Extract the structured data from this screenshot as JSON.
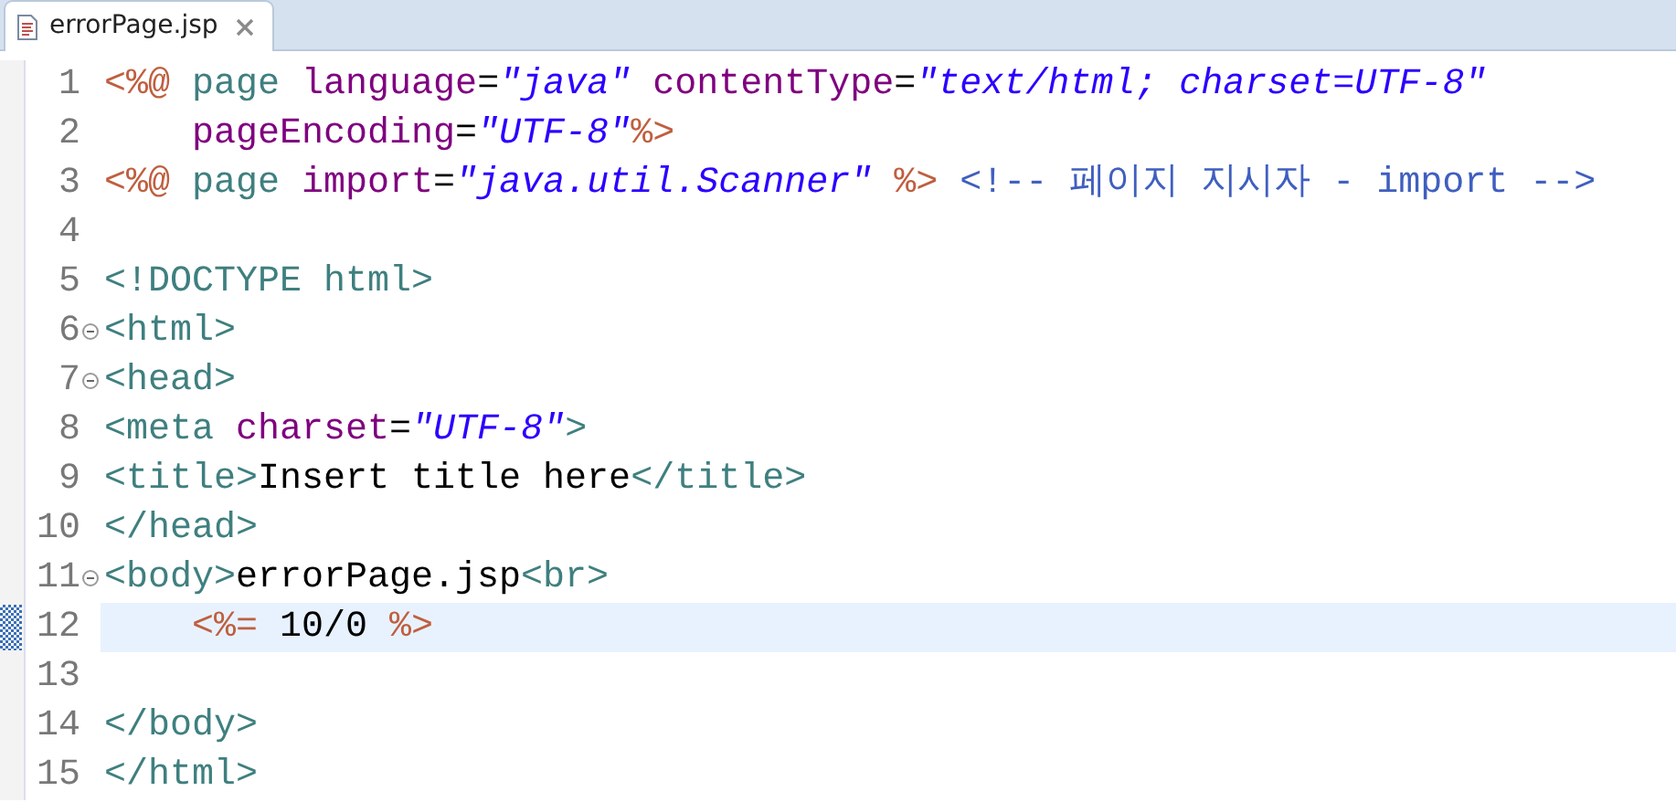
{
  "tab": {
    "title": "errorPage.jsp",
    "selected": true
  },
  "lines": [
    {
      "number": "1",
      "foldable": false,
      "current": false,
      "tokens": [
        {
          "kind": "jsp",
          "text": "<%@"
        },
        {
          "kind": "tag",
          "text": " page"
        },
        {
          "kind": "attr",
          "text": " language"
        },
        {
          "kind": "text",
          "text": "="
        },
        {
          "kind": "string",
          "text": "\"java\""
        },
        {
          "kind": "attr",
          "text": " contentType"
        },
        {
          "kind": "text",
          "text": "="
        },
        {
          "kind": "string",
          "text": "\"text/html; charset=UTF-8\""
        }
      ]
    },
    {
      "number": "2",
      "foldable": false,
      "current": false,
      "tokens": [
        {
          "kind": "attr",
          "text": "    pageEncoding"
        },
        {
          "kind": "text",
          "text": "="
        },
        {
          "kind": "string",
          "text": "\"UTF-8\""
        },
        {
          "kind": "jsp",
          "text": "%>"
        }
      ]
    },
    {
      "number": "3",
      "foldable": false,
      "current": false,
      "tokens": [
        {
          "kind": "jsp",
          "text": "<%@"
        },
        {
          "kind": "tag",
          "text": " page"
        },
        {
          "kind": "attr",
          "text": " import"
        },
        {
          "kind": "text",
          "text": "="
        },
        {
          "kind": "string",
          "text": "\"java.util.Scanner\""
        },
        {
          "kind": "jsp",
          "text": " %>"
        },
        {
          "kind": "comment",
          "text": " <!-- 페이지 지시자 - import -->"
        }
      ]
    },
    {
      "number": "4",
      "foldable": false,
      "current": false
    },
    {
      "number": "5",
      "foldable": false,
      "current": false,
      "tokens": [
        {
          "kind": "tag",
          "text": "<!DOCTYPE html>"
        }
      ]
    },
    {
      "number": "6",
      "foldable": true,
      "current": false,
      "tokens": [
        {
          "kind": "tag",
          "text": "<html>"
        }
      ]
    },
    {
      "number": "7",
      "foldable": true,
      "current": false,
      "tokens": [
        {
          "kind": "tag",
          "text": "<head>"
        }
      ]
    },
    {
      "number": "8",
      "foldable": false,
      "current": false,
      "tokens": [
        {
          "kind": "tag",
          "text": "<meta"
        },
        {
          "kind": "attr",
          "text": " charset"
        },
        {
          "kind": "text",
          "text": "="
        },
        {
          "kind": "string",
          "text": "\"UTF-8\""
        },
        {
          "kind": "tag",
          "text": ">"
        }
      ]
    },
    {
      "number": "9",
      "foldable": false,
      "current": false,
      "tokens": [
        {
          "kind": "tag",
          "text": "<title>"
        },
        {
          "kind": "text",
          "text": "Insert title here"
        },
        {
          "kind": "tag",
          "text": "</title>"
        }
      ]
    },
    {
      "number": "10",
      "foldable": false,
      "current": false,
      "tokens": [
        {
          "kind": "tag",
          "text": "</head>"
        }
      ]
    },
    {
      "number": "11",
      "foldable": true,
      "current": false,
      "tokens": [
        {
          "kind": "tag",
          "text": "<body>"
        },
        {
          "kind": "text",
          "text": "errorPage.jsp"
        },
        {
          "kind": "tag",
          "text": "<br>"
        }
      ]
    },
    {
      "number": "12",
      "foldable": false,
      "current": true,
      "tokens": [
        {
          "kind": "jsp",
          "text": "    <%="
        },
        {
          "kind": "text",
          "text": " 10/0 "
        },
        {
          "kind": "jsp",
          "text": "%>"
        }
      ]
    },
    {
      "number": "13",
      "foldable": false,
      "current": false
    },
    {
      "number": "14",
      "foldable": false,
      "current": false,
      "tokens": [
        {
          "kind": "tag",
          "text": "</body>"
        }
      ]
    },
    {
      "number": "15",
      "foldable": false,
      "current": false,
      "tokens": [
        {
          "kind": "tag",
          "text": "</html>"
        }
      ]
    }
  ]
}
